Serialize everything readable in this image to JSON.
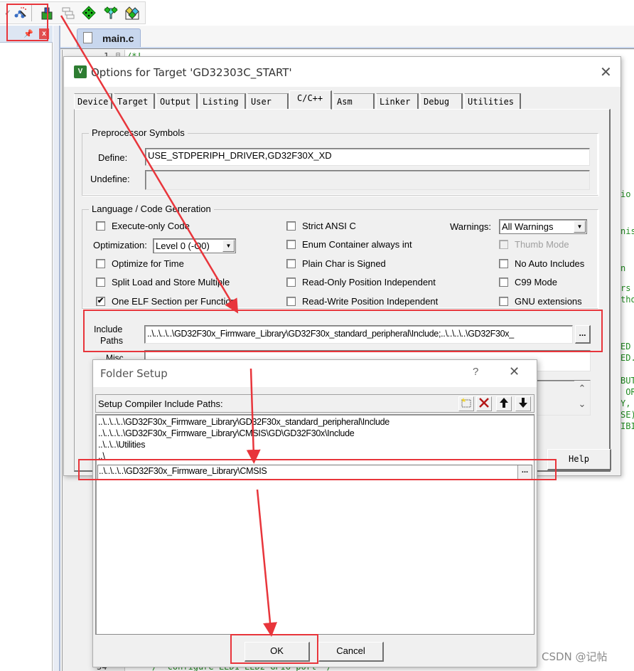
{
  "toolbar": {
    "icons": [
      "options-for-target-icon",
      "select-device-icon",
      "manage-multi-project-icon",
      "manage-project-items-icon",
      "select-packs-icon",
      "manage-run-time-environment-icon"
    ]
  },
  "left_panel": {
    "pin_glyph": "↑",
    "close_glyph": "x"
  },
  "editor": {
    "file_tab": "main.c",
    "first_line_number": "1",
    "first_line_code": "/*!",
    "last_line_number": "54",
    "last_line_code": "/* configure LED1 LED2 GPIO port */",
    "right_fragments": [
      "io",
      "nis",
      "n",
      "rs",
      "tho",
      "ED",
      "ED.",
      "BUT",
      " OR",
      "Y,",
      "SE)",
      "IBI"
    ]
  },
  "options_dialog": {
    "title": "Options for Target 'GD32303C_START'",
    "close_glyph": "✕",
    "tabs": [
      "Device",
      "Target",
      "Output",
      "Listing",
      "User",
      "C/C++",
      "Asm",
      "Linker",
      "Debug",
      "Utilities"
    ],
    "active_tab": "C/C++",
    "preprocessor": {
      "group_label": "Preprocessor Symbols",
      "define_label": "Define:",
      "define_value": "USE_STDPERIPH_DRIVER,GD32F30X_XD",
      "undefine_label": "Undefine:",
      "undefine_value": ""
    },
    "language": {
      "group_label": "Language / Code Generation",
      "execute_only_code": {
        "label": "Execute-only Code",
        "checked": false
      },
      "optimization_label": "Optimization:",
      "optimization_value": "Level 0 (-O0)",
      "optimize_for_time": {
        "label": "Optimize for Time",
        "checked": false
      },
      "split_load_store": {
        "label": "Split Load and Store Multiple",
        "checked": false
      },
      "one_elf_section": {
        "label": "One ELF Section per Function",
        "checked": true
      },
      "strict_ansi_c": {
        "label": "Strict ANSI C",
        "checked": false
      },
      "enum_container": {
        "label": "Enum Container always int",
        "checked": false
      },
      "plain_char_signed": {
        "label": "Plain Char is Signed",
        "checked": false
      },
      "read_only_pi": {
        "label": "Read-Only Position Independent",
        "checked": false
      },
      "read_write_pi": {
        "label": "Read-Write Position Independent",
        "checked": false
      },
      "warnings_label": "Warnings:",
      "warnings_value": "All Warnings",
      "thumb_mode": {
        "label": "Thumb Mode",
        "checked": false,
        "disabled": true
      },
      "no_auto_includes": {
        "label": "No Auto Includes",
        "checked": false
      },
      "c99_mode": {
        "label": "C99 Mode",
        "checked": false
      },
      "gnu_extensions": {
        "label": "GNU extensions",
        "checked": false
      }
    },
    "include_paths_label_1": "Include",
    "include_paths_label_2": "Paths",
    "include_paths_value": "..\\..\\..\\..\\GD32F30x_Firmware_Library\\GD32F30x_standard_peripheral\\Include;..\\..\\..\\..\\GD32F30x_",
    "browse_label": "...",
    "misc_label": "Misc",
    "help_button": "Help"
  },
  "folder_dialog": {
    "title": "Folder Setup",
    "help_glyph": "?",
    "close_glyph": "✕",
    "header_label": "Setup Compiler Include Paths:",
    "toolbar_buttons": [
      {
        "name": "new-folder-button",
        "glyph": "⬚"
      },
      {
        "name": "delete-button",
        "glyph": "✕"
      },
      {
        "name": "move-up-button",
        "glyph": "🡅"
      },
      {
        "name": "move-down-button",
        "glyph": "🡇"
      }
    ],
    "paths": [
      "..\\..\\..\\..\\GD32F30x_Firmware_Library\\GD32F30x_standard_peripheral\\Include",
      "..\\..\\..\\..\\GD32F30x_Firmware_Library\\CMSIS\\GD\\GD32F30x\\Include",
      "..\\..\\..\\Utilities",
      "..\\"
    ],
    "editing_path": "..\\..\\..\\..\\GD32F30x_Firmware_Library\\CMSIS",
    "browse_label": "...",
    "ok_button": "OK",
    "cancel_button": "Cancel"
  },
  "annotations": {
    "color": "#e8353b"
  },
  "watermark": "CSDN @记帖"
}
